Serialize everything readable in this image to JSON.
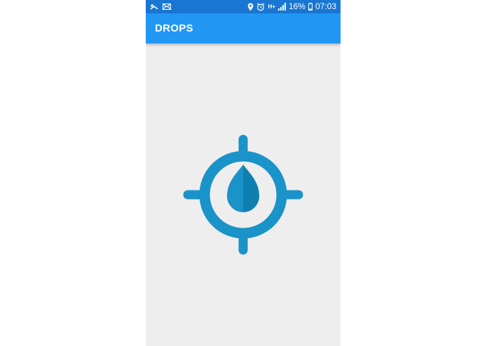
{
  "status_bar": {
    "battery_percent": "16%",
    "time": "07:03",
    "network_label": "H+",
    "icons": [
      "missed-call-icon",
      "mail-icon",
      "location-icon",
      "alarm-icon",
      "signal-icon",
      "battery-icon"
    ]
  },
  "app_bar": {
    "title": "DROPS"
  },
  "logo": {
    "icon": "drop-target-icon",
    "colors": {
      "primary": "#1a93c8",
      "dark": "#0f7fb0",
      "background": "#eeeeee"
    }
  },
  "colors": {
    "status_bar": "#1976d2",
    "app_bar": "#2196f3",
    "content_background": "#eeeeee"
  }
}
